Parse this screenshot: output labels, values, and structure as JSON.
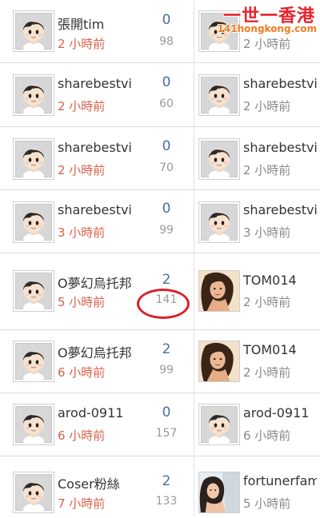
{
  "logo": {
    "title": "一世一香港",
    "url": "141hongkong.com"
  },
  "rows": [
    {
      "left": {
        "name": "張開tim",
        "time": "2 小時前",
        "replies": "0",
        "views": "98"
      },
      "right": {
        "name": "",
        "time": "2 小時前",
        "avatar": "default"
      }
    },
    {
      "left": {
        "name": "sharebestvi",
        "time": "2 小時前",
        "replies": "0",
        "views": "60"
      },
      "right": {
        "name": "sharebestvi",
        "time": "2 小時前",
        "avatar": "default"
      }
    },
    {
      "left": {
        "name": "sharebestvi",
        "time": "2 小時前",
        "replies": "0",
        "views": "70"
      },
      "right": {
        "name": "sharebestvi",
        "time": "2 小時前",
        "avatar": "default"
      }
    },
    {
      "left": {
        "name": "sharebestvi",
        "time": "3 小時前",
        "replies": "0",
        "views": "99"
      },
      "right": {
        "name": "sharebestvi",
        "time": "3 小時前",
        "avatar": "default"
      }
    },
    {
      "left": {
        "name": "O夢幻烏托邦",
        "time": "5 小時前",
        "replies": "2",
        "views": "141"
      },
      "right": {
        "name": "TOM014",
        "time": "2 小時前",
        "avatar": "photo-woman"
      }
    },
    {
      "left": {
        "name": "O夢幻烏托邦",
        "time": "6 小時前",
        "replies": "2",
        "views": "99"
      },
      "right": {
        "name": "TOM014",
        "time": "2 小時前",
        "avatar": "photo-woman"
      }
    },
    {
      "left": {
        "name": "arod-0911",
        "time": "6 小時前",
        "replies": "0",
        "views": "157"
      },
      "right": {
        "name": "arod-0911",
        "time": "6 小時前",
        "avatar": "default"
      }
    },
    {
      "left": {
        "name": "Coser粉絲",
        "time": "7 小時前",
        "replies": "2",
        "views": "133"
      },
      "right": {
        "name": "fortunerfam",
        "time": "5 小時前",
        "avatar": "photo-woman-2"
      }
    }
  ],
  "highlight": {
    "row": 4,
    "field": "views",
    "color": "#d8202a"
  }
}
